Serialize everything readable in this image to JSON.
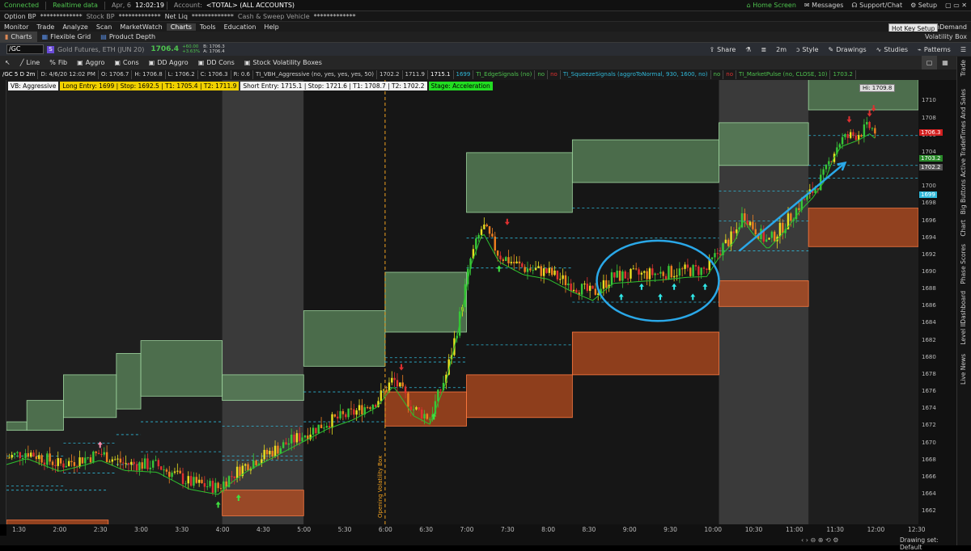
{
  "status_bar": {
    "connected": "Connected",
    "realtime": "Realtime data",
    "date": "Apr, 6",
    "time": "12:02:19",
    "account_label": "Account:",
    "account_value": "<TOTAL> (ALL ACCOUNTS)",
    "home_screen": "Home Screen",
    "messages": "Messages",
    "support": "Support/Chat",
    "setup": "Setup"
  },
  "balances": {
    "option_bp": "Option BP",
    "option_bp_value": "*************",
    "stock_bp": "Stock BP",
    "stock_bp_value": "*************",
    "net_liq": "Net Liq",
    "net_liq_value": "*************",
    "cash_sweep": "Cash & Sweep Vehicle",
    "cash_sweep_value": "*************"
  },
  "menu": {
    "items": [
      "Monitor",
      "Trade",
      "Analyze",
      "Scan",
      "MarketWatch",
      "Charts",
      "Tools",
      "Education",
      "Help"
    ],
    "active": "Charts",
    "ondemand": "OnDemand"
  },
  "tooltip": "Hot Key Setup",
  "subtabs": {
    "charts": "Charts",
    "flexible_grid": "Flexible Grid",
    "product_depth": "Product Depth",
    "volatility_box": "Volatility Box"
  },
  "symbol_bar": {
    "symbol": "/GC",
    "badge": "S",
    "description": "Gold Futures, ETH (JUN 20)",
    "last": "1706.4",
    "change": "+60.00",
    "change_pct": "+3.63%",
    "bid": "B: 1706.3",
    "ask": "A: 1706.4",
    "share": "Share",
    "timeframe": "2m",
    "style": "Style",
    "drawings": "Drawings",
    "studies": "Studies",
    "patterns": "Patterns"
  },
  "toolbar": {
    "line": "Line",
    "fib": "Fib",
    "aggro": "Aggro",
    "cons": "Cons",
    "dd_aggro": "DD Aggro",
    "dd_cons": "DD Cons",
    "stock_vol": "Stock Volatility Boxes"
  },
  "study_row": [
    "/GC 5 D 2m",
    "D: 4/6/20 12:02 PM",
    "O: 1706.7",
    "H: 1706.8",
    "L: 1706.2",
    "C: 1706.3",
    "R: 0.6",
    "TI_VBH_Aggressive (no, yes, yes, yes, 50)",
    "1702.2",
    "1711.9",
    "1715.1",
    "1699",
    "TI_EdgeSignals (no)",
    "no",
    "no",
    "TI_SqueezeSignals (aggroToNormal, 930, 1600, no)",
    "no",
    "no",
    "TI_MarketPulse (no, CLOSE, 10)",
    "1703.2"
  ],
  "labels": {
    "vb": "VB: Aggressive",
    "long": "Long Entry: 1699 | Stop: 1692.5 | T1: 1705.4 | T2: 1711.9",
    "short": "Short Entry: 1715.1 | Stop: 1721.6 | T1: 1708.7 | T2: 1702.2",
    "stage": "Stage: Acceleration"
  },
  "colors": {
    "green_box": "#5d8a5d",
    "red_box": "#c2501f",
    "long_label": "#f0d000",
    "short_label": "#f2f2f2",
    "stage_label": "#22dd22",
    "cyan": "#2fb8d8"
  },
  "chart_data": {
    "type": "candlestick",
    "symbol": "/GC",
    "aggregation": "2m",
    "ylim": [
      1660.5,
      1712.5
    ],
    "yticks": [
      1662,
      1664,
      1666,
      1668,
      1670,
      1672,
      1674,
      1676,
      1678,
      1680,
      1682,
      1684,
      1686,
      1688,
      1690,
      1692,
      1694,
      1696,
      1698,
      1700,
      1702,
      1704,
      1706,
      1708,
      1710
    ],
    "xticks": [
      "1:30",
      "2:00",
      "2:30",
      "3:00",
      "3:30",
      "4:00",
      "4:30",
      "5:00",
      "5:30",
      "6:00",
      "6:30",
      "7:00",
      "7:30",
      "8:00",
      "8:30",
      "9:00",
      "9:30",
      "10:00",
      "10:30",
      "11:00",
      "11:30",
      "12:00",
      "12:30"
    ],
    "xlim_hours": [
      1.35,
      12.55
    ],
    "price_path": [
      [
        1.35,
        1668.3
      ],
      [
        1.6,
        1669.0
      ],
      [
        2.0,
        1667.5
      ],
      [
        2.3,
        1668.2
      ],
      [
        2.5,
        1668.8
      ],
      [
        2.8,
        1667.6
      ],
      [
        3.2,
        1667.4
      ],
      [
        3.6,
        1665.4
      ],
      [
        3.95,
        1664.8
      ],
      [
        4.1,
        1666.1
      ],
      [
        4.3,
        1667.5
      ],
      [
        4.6,
        1669.0
      ],
      [
        5.0,
        1671.0
      ],
      [
        5.3,
        1672.5
      ],
      [
        5.6,
        1673.5
      ],
      [
        5.9,
        1675.0
      ],
      [
        6.1,
        1677.5
      ],
      [
        6.35,
        1674.0
      ],
      [
        6.55,
        1673.0
      ],
      [
        6.75,
        1678.0
      ],
      [
        6.9,
        1684.0
      ],
      [
        7.05,
        1691.5
      ],
      [
        7.2,
        1695.5
      ],
      [
        7.4,
        1692.0
      ],
      [
        7.7,
        1690.5
      ],
      [
        8.0,
        1690.0
      ],
      [
        8.3,
        1688.5
      ],
      [
        8.55,
        1687.5
      ],
      [
        8.8,
        1689.5
      ],
      [
        9.1,
        1689.7
      ],
      [
        9.4,
        1689.9
      ],
      [
        9.7,
        1690.2
      ],
      [
        9.95,
        1690.3
      ],
      [
        10.1,
        1692.5
      ],
      [
        10.3,
        1694.5
      ],
      [
        10.4,
        1697.0
      ],
      [
        10.5,
        1695.5
      ],
      [
        10.7,
        1693.5
      ],
      [
        10.9,
        1695.5
      ],
      [
        11.1,
        1698.0
      ],
      [
        11.25,
        1699.5
      ],
      [
        11.4,
        1701.5
      ],
      [
        11.5,
        1704.0
      ],
      [
        11.6,
        1705.5
      ],
      [
        11.8,
        1706.2
      ],
      [
        11.95,
        1707.0
      ],
      [
        12.04,
        1706.3
      ]
    ],
    "green_boxes": [
      [
        1.35,
        1.6,
        1671.5,
        1672.5
      ],
      [
        1.6,
        2.05,
        1671.5,
        1675.0
      ],
      [
        2.05,
        2.7,
        1673.0,
        1678.0
      ],
      [
        2.7,
        3.0,
        1674.0,
        1680.5
      ],
      [
        3.0,
        4.0,
        1675.5,
        1682.0
      ],
      [
        4.0,
        5.0,
        1675.0,
        1678.0
      ],
      [
        5.0,
        6.0,
        1679.0,
        1685.5
      ],
      [
        6.0,
        7.0,
        1683.0,
        1690.0
      ],
      [
        7.0,
        8.3,
        1697.0,
        1704.0
      ],
      [
        8.3,
        10.1,
        1700.5,
        1705.5
      ],
      [
        10.1,
        11.2,
        1702.5,
        1707.5
      ],
      [
        11.2,
        12.55,
        1709.0,
        1713.0
      ]
    ],
    "red_boxes": [
      [
        1.35,
        2.6,
        1660.0,
        1661.0
      ],
      [
        4.0,
        5.0,
        1661.5,
        1664.5
      ],
      [
        6.0,
        7.0,
        1672.0,
        1676.0
      ],
      [
        7.0,
        8.3,
        1673.0,
        1678.0
      ],
      [
        8.3,
        10.1,
        1678.0,
        1683.0
      ],
      [
        10.1,
        11.2,
        1686.0,
        1689.0
      ],
      [
        11.2,
        12.55,
        1693.0,
        1697.5
      ]
    ],
    "shaded_sessions": [
      [
        4.0,
        5.0
      ],
      [
        10.1,
        11.2
      ]
    ],
    "vertical_marker": {
      "hour": 6.0,
      "label": "Opening Volatility Box"
    },
    "squeeze_circle": {
      "center": [
        9.35,
        1689.0
      ],
      "rx_hours": 0.75,
      "ry_price": 4.7
    },
    "trend_arrow": [
      [
        10.35,
        1692.5
      ],
      [
        11.65,
        1702.8
      ]
    ],
    "price_bubbles": [
      {
        "value": "1706.3",
        "color": "#d32020"
      },
      {
        "value": "1703.2",
        "color": "#2a8a2a"
      },
      {
        "value": "1702.2",
        "color": "#555555"
      },
      {
        "value": "1699",
        "color": "#2fb8d8"
      }
    ],
    "high_label": "Hi: 1709.8"
  },
  "side_tabs": [
    "Trade",
    "Times And Sales",
    "Active Trader",
    "Big Buttons",
    "Chart",
    "Phase Scores",
    "Dashboard",
    "Level II",
    "Live News"
  ],
  "footer": {
    "drawing_set": "Drawing set: Default"
  }
}
